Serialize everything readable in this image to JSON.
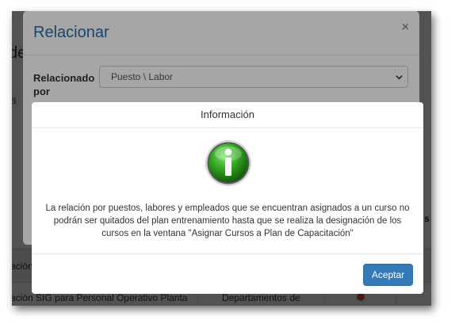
{
  "background_page": {
    "title_fragment": "de",
    "link_fragment": "a",
    "row_top_text": "ación",
    "row_bottom_text": "ación SIG para Personal Operativo Planta",
    "row_bottom_col2": "Departamentos de",
    "right_fragment": "s"
  },
  "relacionar_modal": {
    "title": "Relacionar",
    "close_symbol": "×",
    "label": "Relacionado por",
    "select_value": "Puesto \\ Labor"
  },
  "info_modal": {
    "title": "Información",
    "icon": "info-icon",
    "message": "La relación por puestos, labores y empleados que se encuentran asignados a un curso no podrán ser quitados del plan entrenamiento hasta que se realiza la designación de los cursos en la ventana \"Asignar Cursos a Plan de Capacitación\"",
    "accept_label": "Aceptar"
  },
  "colors": {
    "primary_button": "#337ab7",
    "title_blue": "#2a6aa8",
    "info_icon_green": "#2e9e1e"
  }
}
